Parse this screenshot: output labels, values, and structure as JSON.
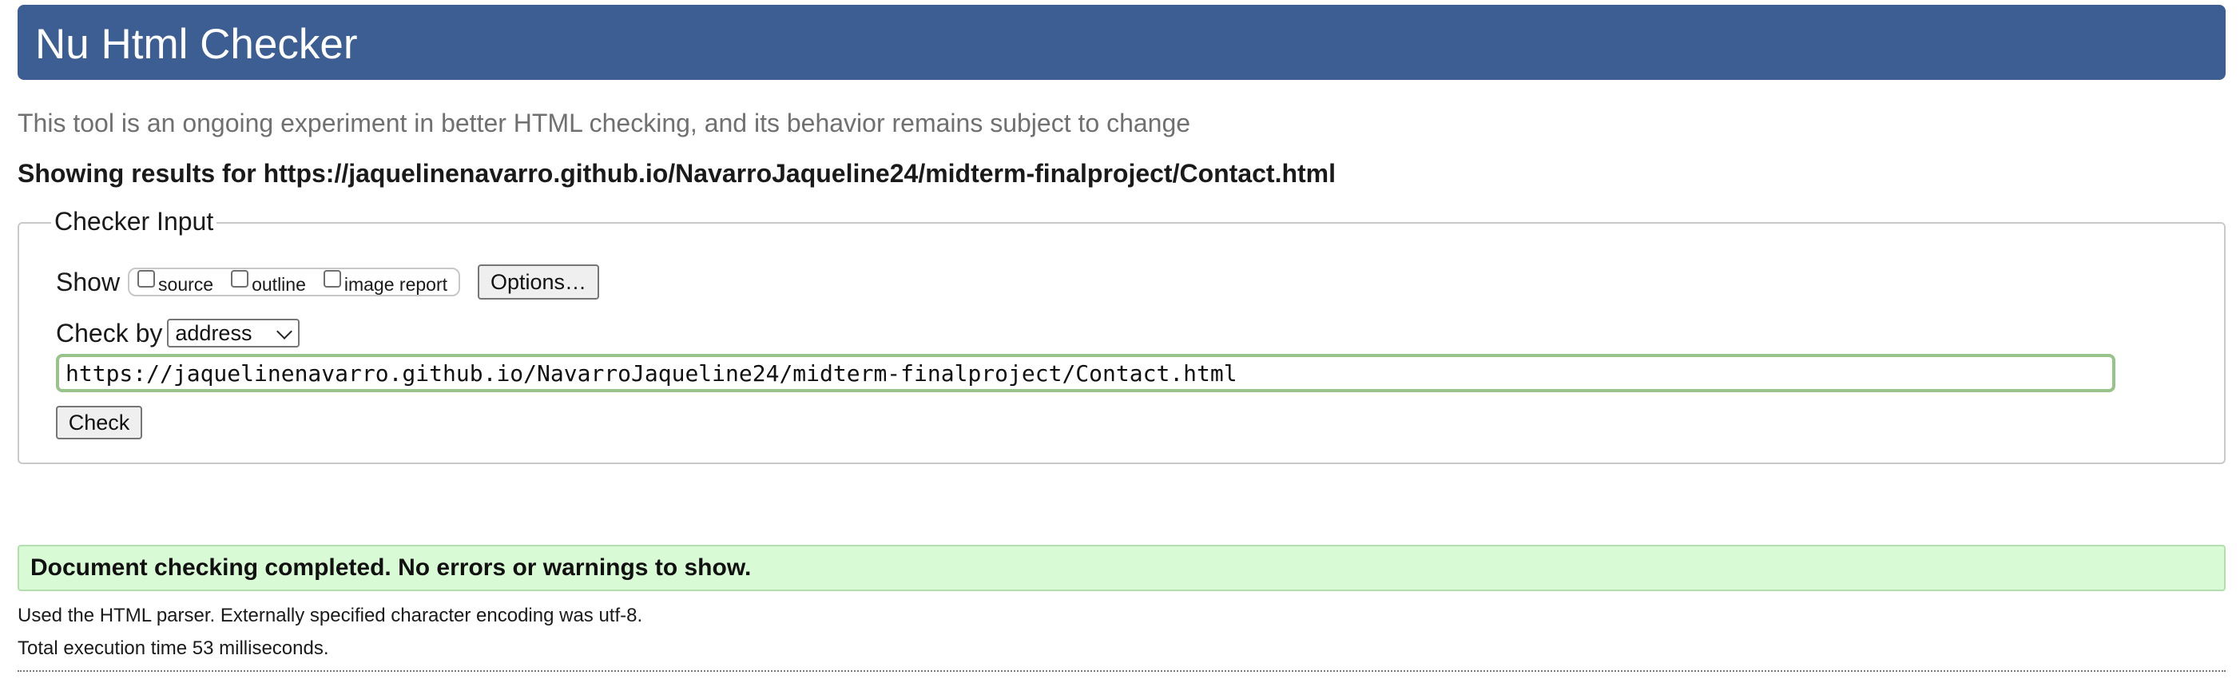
{
  "header": {
    "title": "Nu Html Checker"
  },
  "subtitle": "This tool is an ongoing experiment in better HTML checking, and its behavior remains subject to change",
  "results_heading": "Showing results for https://jaquelinenavarro.github.io/NavarroJaqueline24/midterm-finalproject/Contact.html",
  "checker_input": {
    "legend": "Checker Input",
    "show_label": "Show",
    "options": [
      {
        "label": "source",
        "checked": false
      },
      {
        "label": "outline",
        "checked": false
      },
      {
        "label": "image report",
        "checked": false
      }
    ],
    "options_button": "Options…",
    "check_by_label": "Check by",
    "check_by_value": "address",
    "url_value": "https://jaquelinenavarro.github.io/NavarroJaqueline24/midterm-finalproject/Contact.html",
    "check_button": "Check"
  },
  "result_message": "Document checking completed. No errors or warnings to show.",
  "details": {
    "parser": "Used the HTML parser. Externally specified character encoding was utf-8.",
    "time": "Total execution time 53 milliseconds."
  },
  "colors": {
    "header_bg": "#3d5e93",
    "success_bg": "#d8fbd5",
    "input_focus": "#98c38a"
  }
}
